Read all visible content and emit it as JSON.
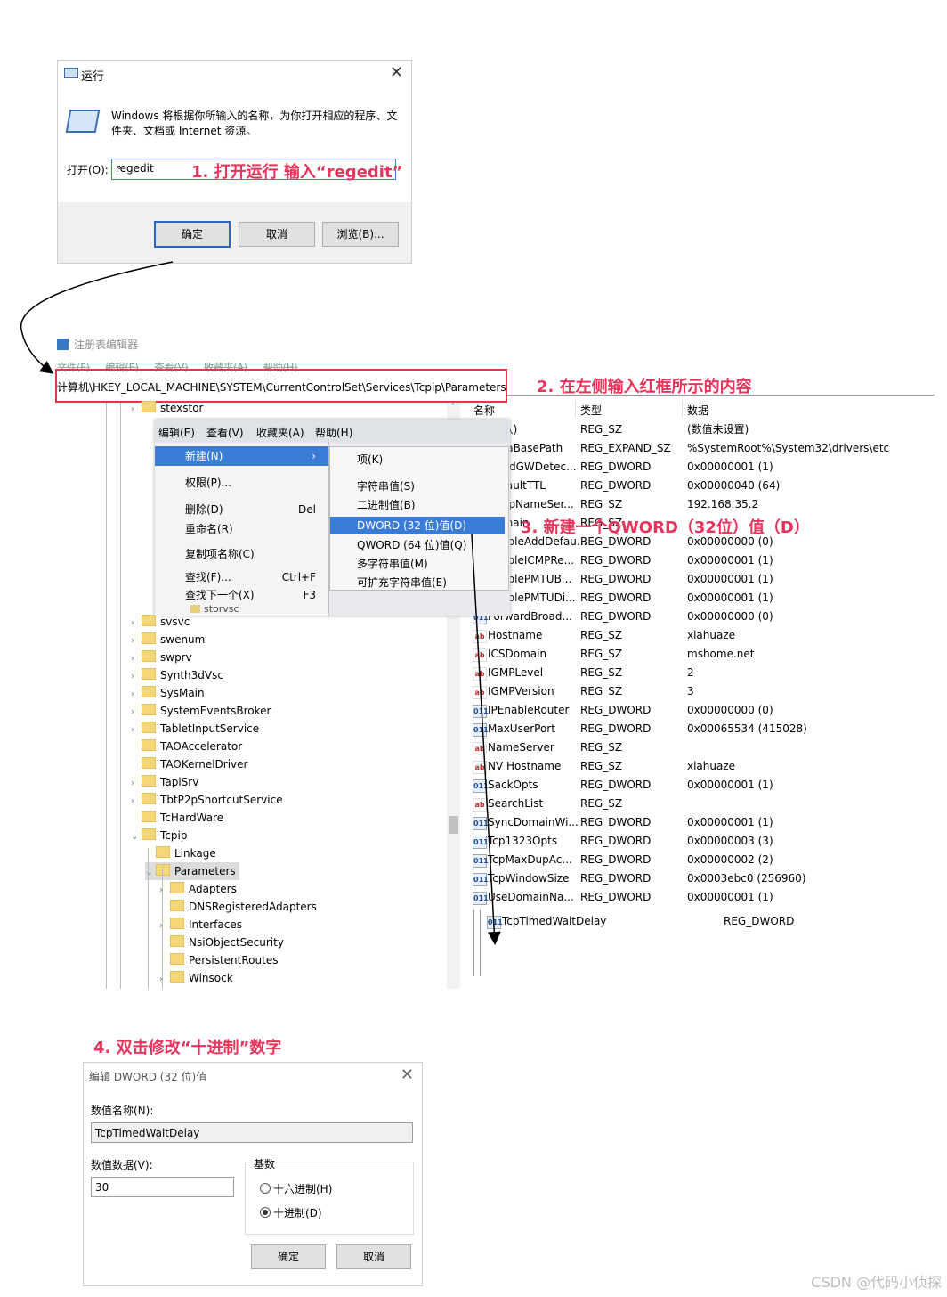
{
  "run_dialog": {
    "title": "运行",
    "description": "Windows 将根据你所输入的名称，为你打开相应的程序、文件夹、文档或 Internet 资源。",
    "open_label": "打开(O):",
    "open_value": "regedit",
    "ok": "确定",
    "cancel": "取消",
    "browse": "浏览(B)..."
  },
  "notes": {
    "step1": "1. 打开运行 输入“regedit”",
    "step2": "2. 在左侧输入红框所示的内容",
    "step3": "3. 新建一个QWORD（32位）值（D）",
    "step4": "4. 双击修改“十进制”数字"
  },
  "regedit": {
    "title": "注册表编辑器",
    "menu": [
      "文件(F)",
      "编辑(E)",
      "查看(V)",
      "收藏夹(A)",
      "帮助(H)"
    ],
    "address": "计算机\\HKEY_LOCAL_MACHINE\\SYSTEM\\CurrentControlSet\\Services\\Tcpip\\Parameters",
    "tree": [
      {
        "label": "stexstor",
        "level": 0,
        "expander": true
      },
      {
        "label": "svsvc",
        "level": 0,
        "expander": true
      },
      {
        "label": "swenum",
        "level": 0,
        "expander": true
      },
      {
        "label": "swprv",
        "level": 0,
        "expander": true
      },
      {
        "label": "Synth3dVsc",
        "level": 0,
        "expander": true
      },
      {
        "label": "SysMain",
        "level": 0,
        "expander": true
      },
      {
        "label": "SystemEventsBroker",
        "level": 0,
        "expander": true
      },
      {
        "label": "TabletInputService",
        "level": 0,
        "expander": true
      },
      {
        "label": "TAOAccelerator",
        "level": 0,
        "expander": false
      },
      {
        "label": "TAOKernelDriver",
        "level": 0,
        "expander": false
      },
      {
        "label": "TapiSrv",
        "level": 0,
        "expander": true
      },
      {
        "label": "TbtP2pShortcutService",
        "level": 0,
        "expander": true
      },
      {
        "label": "TcHardWare",
        "level": 0,
        "expander": false
      },
      {
        "label": "Tcpip",
        "level": 0,
        "expander": "open"
      },
      {
        "label": "Linkage",
        "level": 1,
        "expander": false
      },
      {
        "label": "Parameters",
        "level": 1,
        "expander": "open",
        "selected": true
      },
      {
        "label": "Adapters",
        "level": 2,
        "expander": true
      },
      {
        "label": "DNSRegisteredAdapters",
        "level": 2,
        "expander": false
      },
      {
        "label": "Interfaces",
        "level": 2,
        "expander": true
      },
      {
        "label": "NsiObjectSecurity",
        "level": 2,
        "expander": false
      },
      {
        "label": "PersistentRoutes",
        "level": 2,
        "expander": false
      },
      {
        "label": "Winsock",
        "level": 2,
        "expander": true
      }
    ],
    "columns": {
      "name": "名称",
      "type": "类型",
      "data": "数据"
    },
    "values": [
      {
        "name": "(默认)",
        "type": "REG_SZ",
        "data": "(数值未设置)",
        "kind": "sz"
      },
      {
        "name": "DataBasePath",
        "type": "REG_EXPAND_SZ",
        "data": "%SystemRoot%\\System32\\drivers\\etc",
        "kind": "sz"
      },
      {
        "name": "DeadGWDetec...",
        "type": "REG_DWORD",
        "data": "0x00000001 (1)",
        "kind": "dw"
      },
      {
        "name": "DefaultTTL",
        "type": "REG_DWORD",
        "data": "0x00000040 (64)",
        "kind": "dw"
      },
      {
        "name": "DhcpNameSer...",
        "type": "REG_SZ",
        "data": "192.168.35.2",
        "kind": "sz"
      },
      {
        "name": "Domain",
        "type": "REG_SZ",
        "data": "",
        "kind": "sz"
      },
      {
        "name": "EnableAddDefau...",
        "type": "REG_DWORD",
        "data": "0x00000000 (0)",
        "kind": "dw"
      },
      {
        "name": "EnableICMPRe...",
        "type": "REG_DWORD",
        "data": "0x00000001 (1)",
        "kind": "dw"
      },
      {
        "name": "EnablePMTUB...",
        "type": "REG_DWORD",
        "data": "0x00000001 (1)",
        "kind": "dw"
      },
      {
        "name": "EnablePMTUDi...",
        "type": "REG_DWORD",
        "data": "0x00000001 (1)",
        "kind": "dw"
      },
      {
        "name": "ForwardBroad...",
        "type": "REG_DWORD",
        "data": "0x00000000 (0)",
        "kind": "dw"
      },
      {
        "name": "Hostname",
        "type": "REG_SZ",
        "data": "xiahuaze",
        "kind": "sz"
      },
      {
        "name": "ICSDomain",
        "type": "REG_SZ",
        "data": "mshome.net",
        "kind": "sz"
      },
      {
        "name": "IGMPLevel",
        "type": "REG_SZ",
        "data": "2",
        "kind": "sz"
      },
      {
        "name": "IGMPVersion",
        "type": "REG_SZ",
        "data": "3",
        "kind": "sz"
      },
      {
        "name": "IPEnableRouter",
        "type": "REG_DWORD",
        "data": "0x00000000 (0)",
        "kind": "dw"
      },
      {
        "name": "MaxUserPort",
        "type": "REG_DWORD",
        "data": "0x00065534 (415028)",
        "kind": "dw"
      },
      {
        "name": "NameServer",
        "type": "REG_SZ",
        "data": "",
        "kind": "sz"
      },
      {
        "name": "NV Hostname",
        "type": "REG_SZ",
        "data": "xiahuaze",
        "kind": "sz"
      },
      {
        "name": "SackOpts",
        "type": "REG_DWORD",
        "data": "0x00000001 (1)",
        "kind": "dw"
      },
      {
        "name": "SearchList",
        "type": "REG_SZ",
        "data": "",
        "kind": "sz"
      },
      {
        "name": "SyncDomainWi...",
        "type": "REG_DWORD",
        "data": "0x00000001 (1)",
        "kind": "dw"
      },
      {
        "name": "Tcp1323Opts",
        "type": "REG_DWORD",
        "data": "0x00000003 (3)",
        "kind": "dw"
      },
      {
        "name": "TcpMaxDupAc...",
        "type": "REG_DWORD",
        "data": "0x00000002 (2)",
        "kind": "dw"
      },
      {
        "name": "TcpWindowSize",
        "type": "REG_DWORD",
        "data": "0x0003ebc0 (256960)",
        "kind": "dw"
      },
      {
        "name": "UseDomainNa...",
        "type": "REG_DWORD",
        "data": "0x00000001 (1)",
        "kind": "dw"
      }
    ],
    "new_value": {
      "name": "TcpTimedWaitDelay",
      "type": "REG_DWORD"
    }
  },
  "context_menu": {
    "menubar": [
      "编辑(E)",
      "查看(V)",
      "收藏夹(A)",
      "帮助(H)"
    ],
    "left_items": [
      {
        "label": "新建(N)",
        "shortcut": "›",
        "selected": true
      },
      {
        "label": "权限(P)...",
        "shortcut": ""
      },
      {
        "label": "删除(D)",
        "shortcut": "Del"
      },
      {
        "label": "重命名(R)",
        "shortcut": ""
      },
      {
        "label": "复制项名称(C)",
        "shortcut": ""
      },
      {
        "label": "查找(F)...",
        "shortcut": "Ctrl+F"
      },
      {
        "label": "查找下一个(X)",
        "shortcut": "F3"
      }
    ],
    "right_items": [
      {
        "label": "项(K)",
        "selected": false
      },
      {
        "label": "字符串值(S)",
        "selected": false
      },
      {
        "label": "二进制值(B)",
        "selected": false
      },
      {
        "label": "DWORD (32 位)值(D)",
        "selected": true
      },
      {
        "label": "QWORD (64 位)值(Q)",
        "selected": false
      },
      {
        "label": "多字符串值(M)",
        "selected": false
      },
      {
        "label": "可扩充字符串值(E)",
        "selected": false
      }
    ],
    "tree_peek": "storvsc"
  },
  "edit_dialog": {
    "title": "编辑 DWORD (32 位)值",
    "name_label": "数值名称(N):",
    "name_value": "TcpTimedWaitDelay",
    "data_label": "数值数据(V):",
    "data_value": "30",
    "base_label": "基数",
    "hex": "十六进制(H)",
    "dec": "十进制(D)",
    "ok": "确定",
    "cancel": "取消"
  },
  "watermark": "CSDN @代码小侦探",
  "colors": {
    "annotation": "#e8335a",
    "selection": "#3a7bd5"
  }
}
